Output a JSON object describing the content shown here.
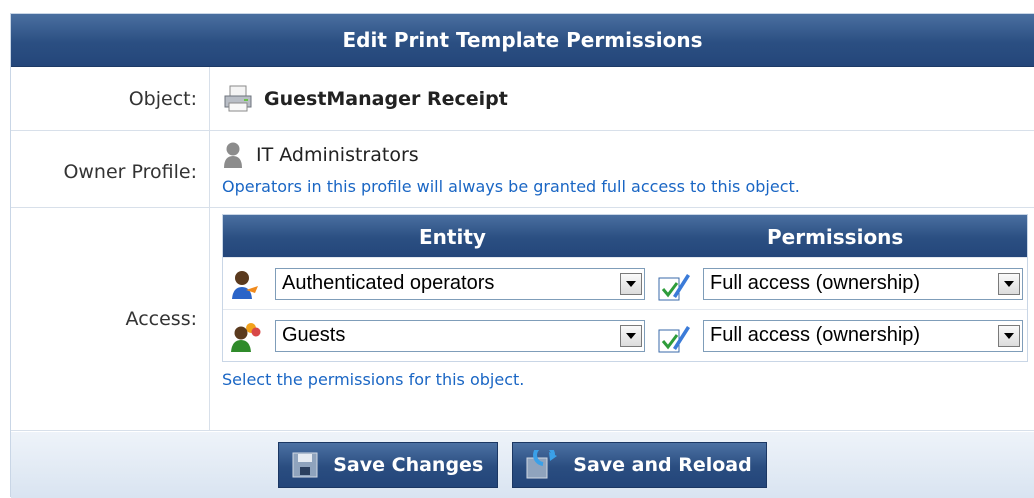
{
  "title": "Edit Print Template Permissions",
  "object": {
    "label": "Object:",
    "name": "GuestManager Receipt",
    "icon": "printer-icon"
  },
  "owner": {
    "label": "Owner Profile:",
    "name": "IT Administrators",
    "icon": "profile-silhouette-icon",
    "hint": "Operators in this profile will always be granted full access to this object."
  },
  "access": {
    "label": "Access:",
    "headers": {
      "entity": "Entity",
      "permissions": "Permissions"
    },
    "rows": [
      {
        "entity": "Authenticated operators",
        "permission": "Full access (ownership)",
        "icon": "operator-user-icon"
      },
      {
        "entity": "Guests",
        "permission": "Full access (ownership)",
        "icon": "guests-group-icon"
      }
    ],
    "hint": "Select the permissions for this object."
  },
  "buttons": {
    "save": "Save Changes",
    "save_reload": "Save and Reload"
  }
}
